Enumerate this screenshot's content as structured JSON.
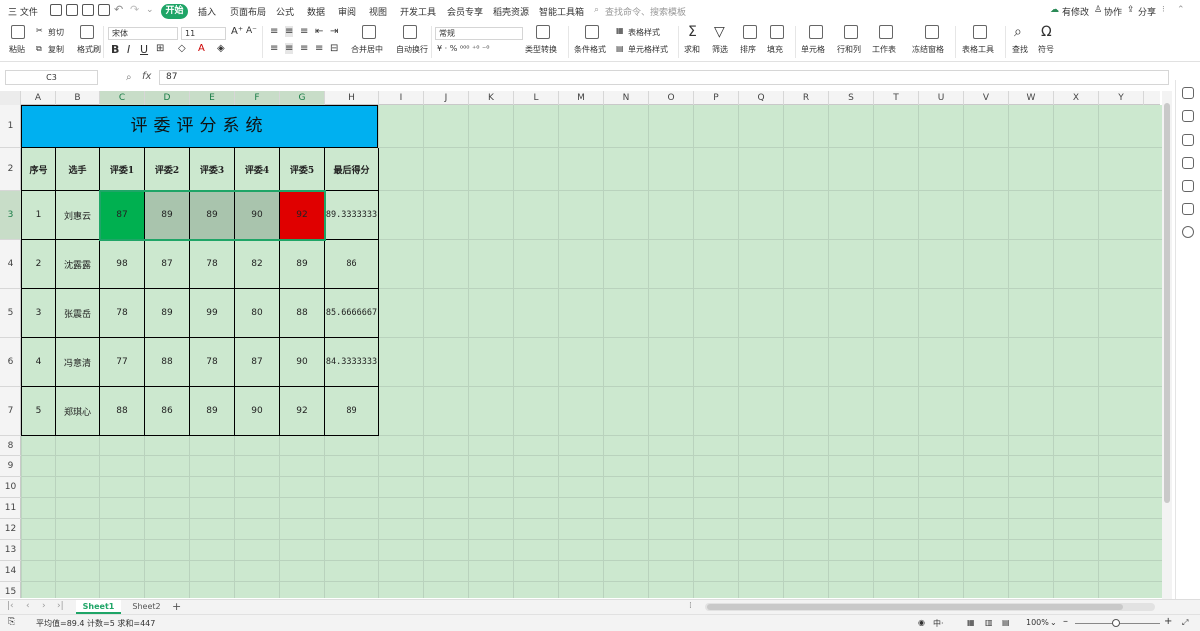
{
  "menu": {
    "file": "三 文件",
    "tabs": [
      "开始",
      "插入",
      "页面布局",
      "公式",
      "数据",
      "审阅",
      "视图",
      "开发工具",
      "会员专享",
      "稻壳资源",
      "智能工具箱"
    ],
    "search_placeholder": "查找命令、搜索模板",
    "right": [
      "有修改",
      "协作",
      "分享"
    ]
  },
  "ribbon": {
    "paste": "粘贴",
    "cut": "剪切",
    "copy": "复制",
    "format_painter": "格式刷",
    "font_name": "宋体",
    "font_size": "11",
    "merge_center": "合并居中",
    "wrap_text": "自动换行",
    "number_format": "常规",
    "currency_percent": "¥ · %  ⁰⁰⁰  ⁺⁰  ⁻⁰",
    "type_convert": "类型转换",
    "cond_format": "条件格式",
    "table_style": "表格样式",
    "cell_style": "单元格样式",
    "sum": "求和",
    "filter": "筛选",
    "sort": "排序",
    "fill": "填充",
    "cell": "单元格",
    "rows_cols": "行和列",
    "worksheet": "工作表",
    "freeze": "冻结窗格",
    "table_tools": "表格工具",
    "find": "查找",
    "symbol": "符号"
  },
  "formula_bar": {
    "name_box": "C3",
    "fx": "fx",
    "value": "87"
  },
  "columns": [
    "A",
    "B",
    "C",
    "D",
    "E",
    "F",
    "G",
    "H",
    "I",
    "J",
    "K",
    "L",
    "M",
    "N",
    "O",
    "P",
    "Q",
    "R",
    "S",
    "T",
    "U",
    "V",
    "W",
    "X",
    "Y"
  ],
  "rows": [
    "1",
    "2",
    "3",
    "4",
    "5",
    "6",
    "7",
    "8",
    "9",
    "10",
    "11",
    "12",
    "13",
    "14",
    "15"
  ],
  "table": {
    "title": "评委评分系统",
    "headers": [
      "序号",
      "选手",
      "评委1",
      "评委2",
      "评委3",
      "评委4",
      "评委5",
      "最后得分"
    ],
    "rows": [
      [
        "1",
        "刘惠云",
        "87",
        "89",
        "89",
        "90",
        "92",
        "89.3333333"
      ],
      [
        "2",
        "沈露露",
        "98",
        "87",
        "78",
        "82",
        "89",
        "86"
      ],
      [
        "3",
        "张震岳",
        "78",
        "89",
        "99",
        "80",
        "88",
        "85.6666667"
      ],
      [
        "4",
        "冯意清",
        "77",
        "88",
        "78",
        "87",
        "90",
        "84.3333333"
      ],
      [
        "5",
        "郑琪心",
        "88",
        "86",
        "89",
        "90",
        "92",
        "89"
      ]
    ]
  },
  "colors": {
    "title_bg": "#00b0f0",
    "sheet_bg": "#cce8cf",
    "min_highlight": "#00b050",
    "max_highlight": "#e00000",
    "selected_gray": "#a9c4ad",
    "accent": "#1fa567"
  },
  "sheets": [
    "Sheet1",
    "Sheet2"
  ],
  "status": {
    "summary": "平均值=89.4  计数=5  求和=447",
    "zoom": "100%"
  }
}
